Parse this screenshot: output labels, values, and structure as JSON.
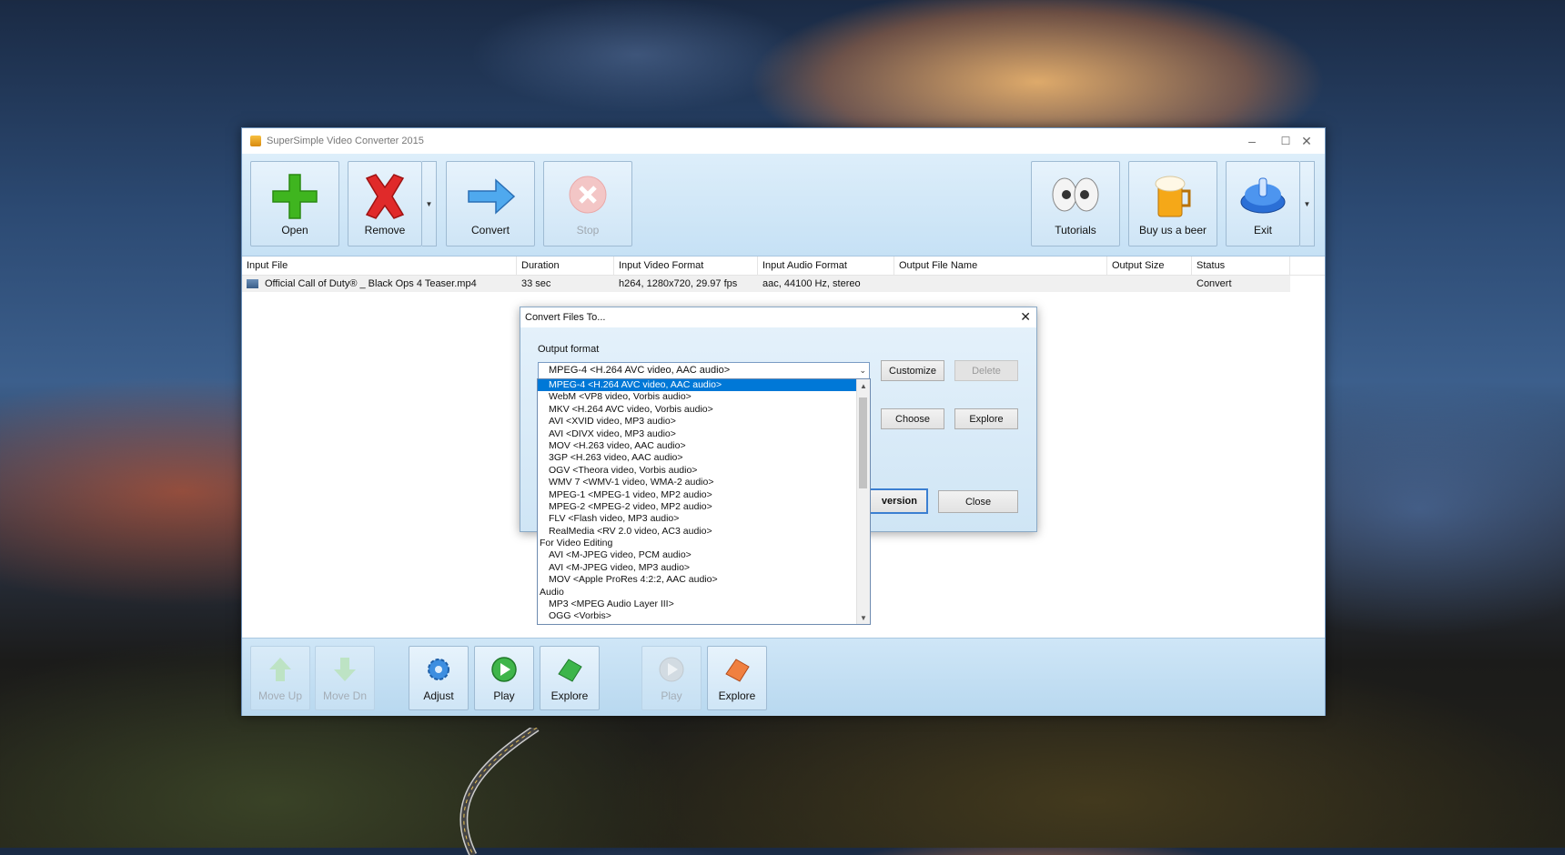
{
  "window": {
    "title": "SuperSimple Video Converter 2015",
    "controls": {
      "minimize": "–",
      "maximize": "☐",
      "close": "✕"
    }
  },
  "toolbar": {
    "open": "Open",
    "remove": "Remove",
    "convert": "Convert",
    "stop": "Stop",
    "tutorials": "Tutorials",
    "beer": "Buy us a beer",
    "exit": "Exit",
    "dropdown_glyph": "▼"
  },
  "table": {
    "headers": [
      "Input File",
      "Duration",
      "Input Video Format",
      "Input Audio Format",
      "Output File Name",
      "Output Size",
      "Status"
    ],
    "rows": [
      {
        "input_file": "Official Call of Duty® _ Black Ops 4 Teaser.mp4",
        "duration": "33 sec",
        "video_format": "h264,  1280x720,  29.97 fps",
        "audio_format": "aac,  44100 Hz, stereo",
        "output_name": "",
        "output_size": "",
        "status": "Convert"
      }
    ]
  },
  "bottombar": {
    "move_up": "Move Up",
    "move_dn": "Move Dn",
    "adjust": "Adjust",
    "play": "Play",
    "explore": "Explore",
    "play2": "Play",
    "explore2": "Explore"
  },
  "dialog": {
    "title": "Convert Files To...",
    "close_glyph": "✕",
    "output_format_label": "Output format",
    "selected_format": "MPEG-4   <H.264 AVC video, AAC audio>",
    "customize": "Customize",
    "delete": "Delete",
    "choose": "Choose",
    "explore": "Explore",
    "start_partial": "version",
    "close": "Close"
  },
  "format_options": [
    {
      "label": "MPEG-4   <H.264 AVC video, AAC audio>",
      "group": false,
      "selected": true
    },
    {
      "label": "WebM   <VP8 video, Vorbis audio>",
      "group": false
    },
    {
      "label": "MKV   <H.264 AVC video, Vorbis audio>",
      "group": false
    },
    {
      "label": "AVI   <XVID video, MP3 audio>",
      "group": false
    },
    {
      "label": "AVI   <DIVX video, MP3 audio>",
      "group": false
    },
    {
      "label": "MOV   <H.263 video, AAC audio>",
      "group": false
    },
    {
      "label": "3GP   <H.263 video, AAC audio>",
      "group": false
    },
    {
      "label": "OGV   <Theora video, Vorbis audio>",
      "group": false
    },
    {
      "label": "WMV 7   <WMV-1 video, WMA-2 audio>",
      "group": false
    },
    {
      "label": "MPEG-1   <MPEG-1 video, MP2 audio>",
      "group": false
    },
    {
      "label": "MPEG-2   <MPEG-2 video, MP2 audio>",
      "group": false
    },
    {
      "label": "FLV   <Flash video, MP3 audio>",
      "group": false
    },
    {
      "label": "RealMedia   <RV 2.0 video, AC3 audio>",
      "group": false
    },
    {
      "label": "For Video Editing",
      "group": true
    },
    {
      "label": "AVI   <M-JPEG video, PCM audio>",
      "group": false
    },
    {
      "label": "AVI   <M-JPEG video, MP3 audio>",
      "group": false
    },
    {
      "label": "MOV   <Apple ProRes 4:2:2, AAC audio>",
      "group": false
    },
    {
      "label": "Audio",
      "group": true
    },
    {
      "label": "MP3   <MPEG Audio Layer III>",
      "group": false
    },
    {
      "label": "OGG   <Vorbis>",
      "group": false
    }
  ],
  "scroll": {
    "up": "▲",
    "down": "▼"
  },
  "colors": {
    "accent": "#0078d7",
    "toolbar": "#cfe5f6",
    "selection": "#0078d7"
  }
}
